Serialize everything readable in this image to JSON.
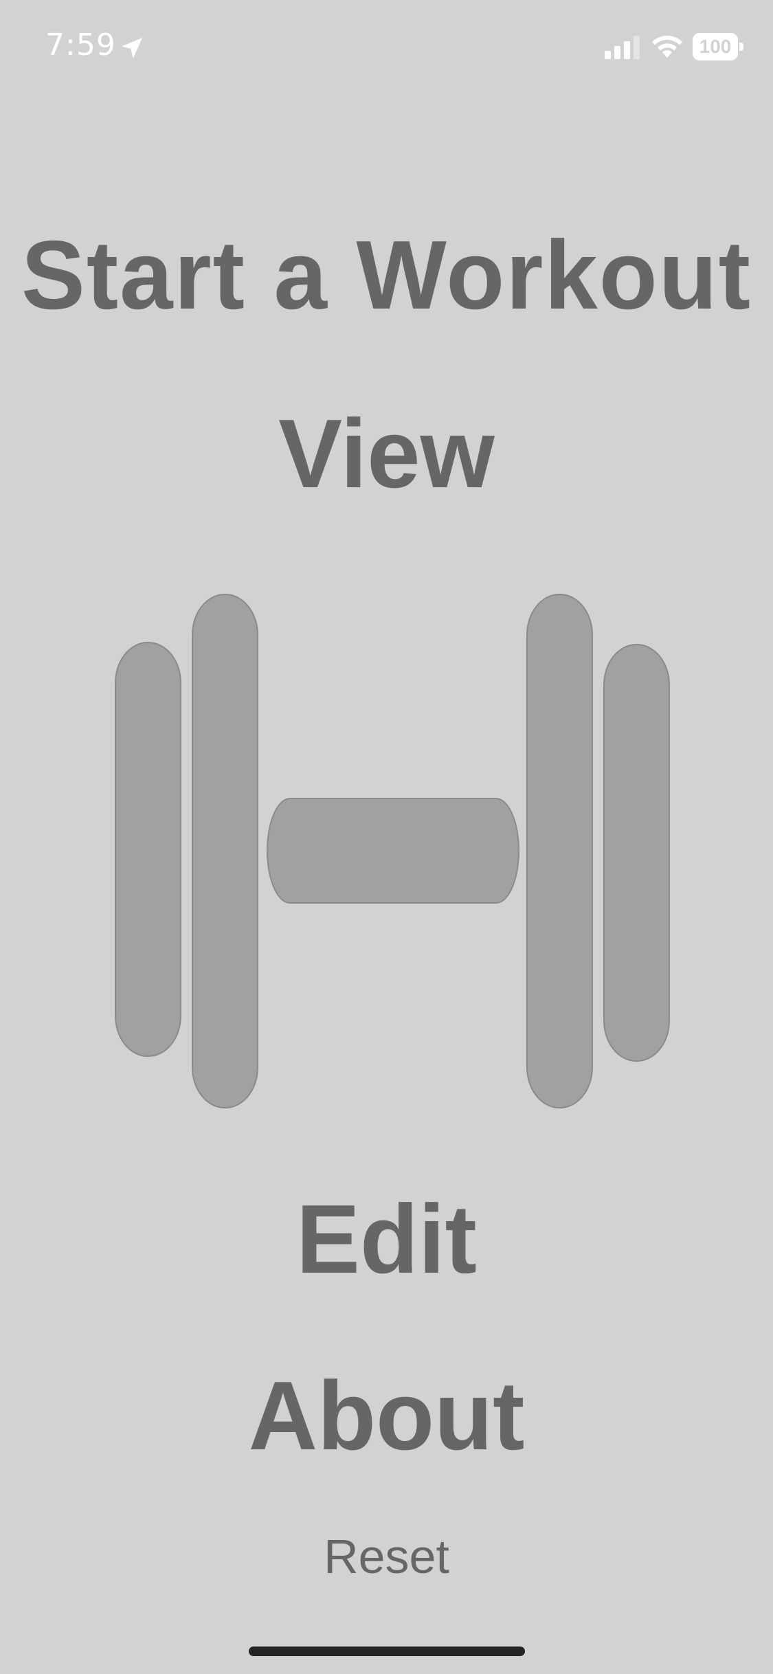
{
  "status_bar": {
    "time": "7:59",
    "battery_level": "100",
    "icons": [
      "location-arrow-icon",
      "cellular-signal-icon",
      "wifi-icon",
      "battery-icon"
    ],
    "text_color": "#ffffff"
  },
  "menu": {
    "start_workout_label": "Start a Workout",
    "view_label": "View",
    "edit_label": "Edit",
    "about_label": "About",
    "reset_label": "Reset"
  },
  "illustration": {
    "icon": "dumbbell-icon",
    "fill_color": "#a1a1a1"
  },
  "colors": {
    "background": "#d2d2d2",
    "text": "#666666"
  }
}
